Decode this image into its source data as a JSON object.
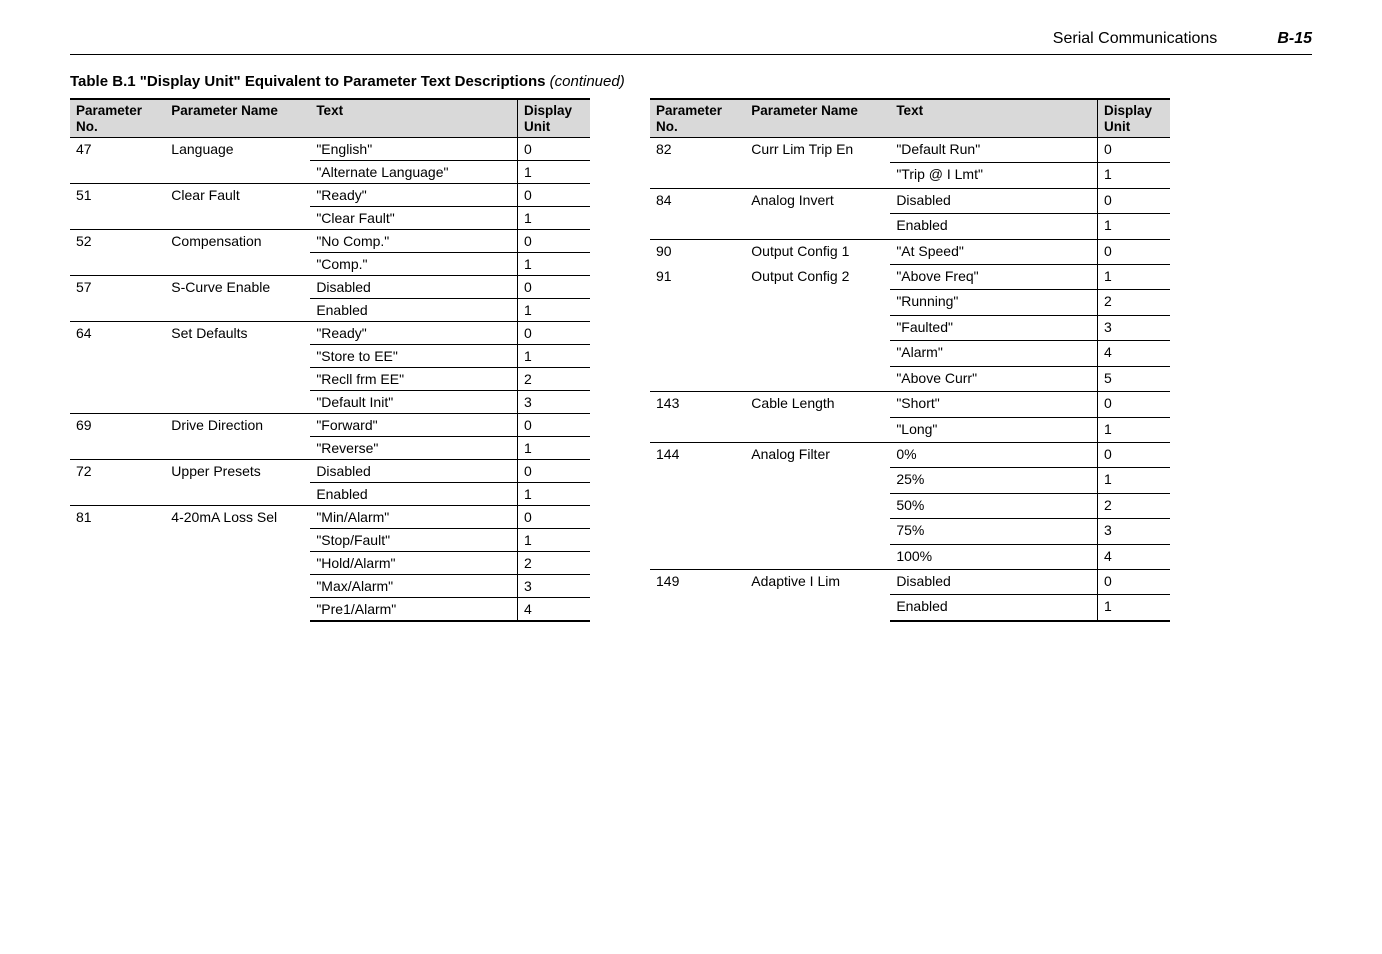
{
  "header": {
    "section": "Serial Communications",
    "page": "B-15"
  },
  "caption": {
    "prefix": "Table B.1",
    "title": "\"Display Unit\" Equivalent to Parameter Text Descriptions",
    "suffix": "(continued)"
  },
  "columns": {
    "no": "Parameter No.",
    "name": "Parameter Name",
    "text": "Text",
    "unit": "Display Unit"
  },
  "left": [
    {
      "no": "47",
      "name": "Language",
      "rows": [
        {
          "text": "\"English\"",
          "unit": "0"
        },
        {
          "text": "\"Alternate Language\"",
          "unit": "1"
        }
      ]
    },
    {
      "no": "51",
      "name": "Clear Fault",
      "rows": [
        {
          "text": "\"Ready\"",
          "unit": "0"
        },
        {
          "text": "\"Clear Fault\"",
          "unit": "1"
        }
      ]
    },
    {
      "no": "52",
      "name": "Compensation",
      "rows": [
        {
          "text": "\"No Comp.\"",
          "unit": "0"
        },
        {
          "text": "\"Comp.\"",
          "unit": "1"
        }
      ]
    },
    {
      "no": "57",
      "name": "S-Curve Enable",
      "rows": [
        {
          "text": "Disabled",
          "unit": "0"
        },
        {
          "text": "Enabled",
          "unit": "1"
        }
      ]
    },
    {
      "no": "64",
      "name": "Set Defaults",
      "rows": [
        {
          "text": "\"Ready\"",
          "unit": "0"
        },
        {
          "text": "\"Store to EE\"",
          "unit": "1"
        },
        {
          "text": "\"Recll frm EE\"",
          "unit": "2"
        },
        {
          "text": "\"Default Init\"",
          "unit": "3"
        }
      ]
    },
    {
      "no": "69",
      "name": "Drive Direction",
      "rows": [
        {
          "text": "\"Forward\"",
          "unit": "0"
        },
        {
          "text": "\"Reverse\"",
          "unit": "1"
        }
      ]
    },
    {
      "no": "72",
      "name": "Upper Presets",
      "rows": [
        {
          "text": "Disabled",
          "unit": "0"
        },
        {
          "text": "Enabled",
          "unit": "1"
        }
      ]
    },
    {
      "no": "81",
      "name": "4-20mA Loss Sel",
      "rows": [
        {
          "text": "\"Min/Alarm\"",
          "unit": "0"
        },
        {
          "text": "\"Stop/Fault\"",
          "unit": "1"
        },
        {
          "text": "\"Hold/Alarm\"",
          "unit": "2"
        },
        {
          "text": "\"Max/Alarm\"",
          "unit": "3"
        },
        {
          "text": "\"Pre1/Alarm\"",
          "unit": "4"
        }
      ]
    }
  ],
  "right": [
    {
      "no": "82",
      "name": "Curr Lim Trip En",
      "rows": [
        {
          "text": "\"Default Run\"",
          "unit": "0"
        },
        {
          "text": "\"Trip @ I Lmt\"",
          "unit": "1"
        }
      ]
    },
    {
      "no": "84",
      "name": "Analog Invert",
      "rows": [
        {
          "text": "Disabled",
          "unit": "0"
        },
        {
          "text": "Enabled",
          "unit": "1"
        }
      ]
    },
    {
      "no": "90",
      "name": "Output Config 1",
      "rows": [
        {
          "text": "\"At Speed\"",
          "unit": "0"
        }
      ]
    },
    {
      "no": "91",
      "name": "Output  Config 2",
      "noTopNo": true,
      "rows": [
        {
          "text": "\"Above Freq\"",
          "unit": "1"
        },
        {
          "text": "\"Running\"",
          "unit": "2"
        },
        {
          "text": "\"Faulted\"",
          "unit": "3"
        },
        {
          "text": "\"Alarm\"",
          "unit": "4"
        },
        {
          "text": "\"Above Curr\"",
          "unit": "5"
        }
      ]
    },
    {
      "no": "143",
      "name": "Cable Length",
      "rows": [
        {
          "text": "\"Short\"",
          "unit": "0"
        },
        {
          "text": "\"Long\"",
          "unit": "1"
        }
      ]
    },
    {
      "no": "144",
      "name": "Analog Filter",
      "rows": [
        {
          "text": "0%",
          "unit": "0"
        },
        {
          "text": "25%",
          "unit": "1"
        },
        {
          "text": "50%",
          "unit": "2"
        },
        {
          "text": "75%",
          "unit": "3"
        },
        {
          "text": "100%",
          "unit": "4"
        }
      ]
    },
    {
      "no": "149",
      "name": "Adaptive I Lim",
      "rows": [
        {
          "text": "Disabled",
          "unit": "0"
        },
        {
          "text": "Enabled",
          "unit": "1"
        }
      ]
    }
  ]
}
